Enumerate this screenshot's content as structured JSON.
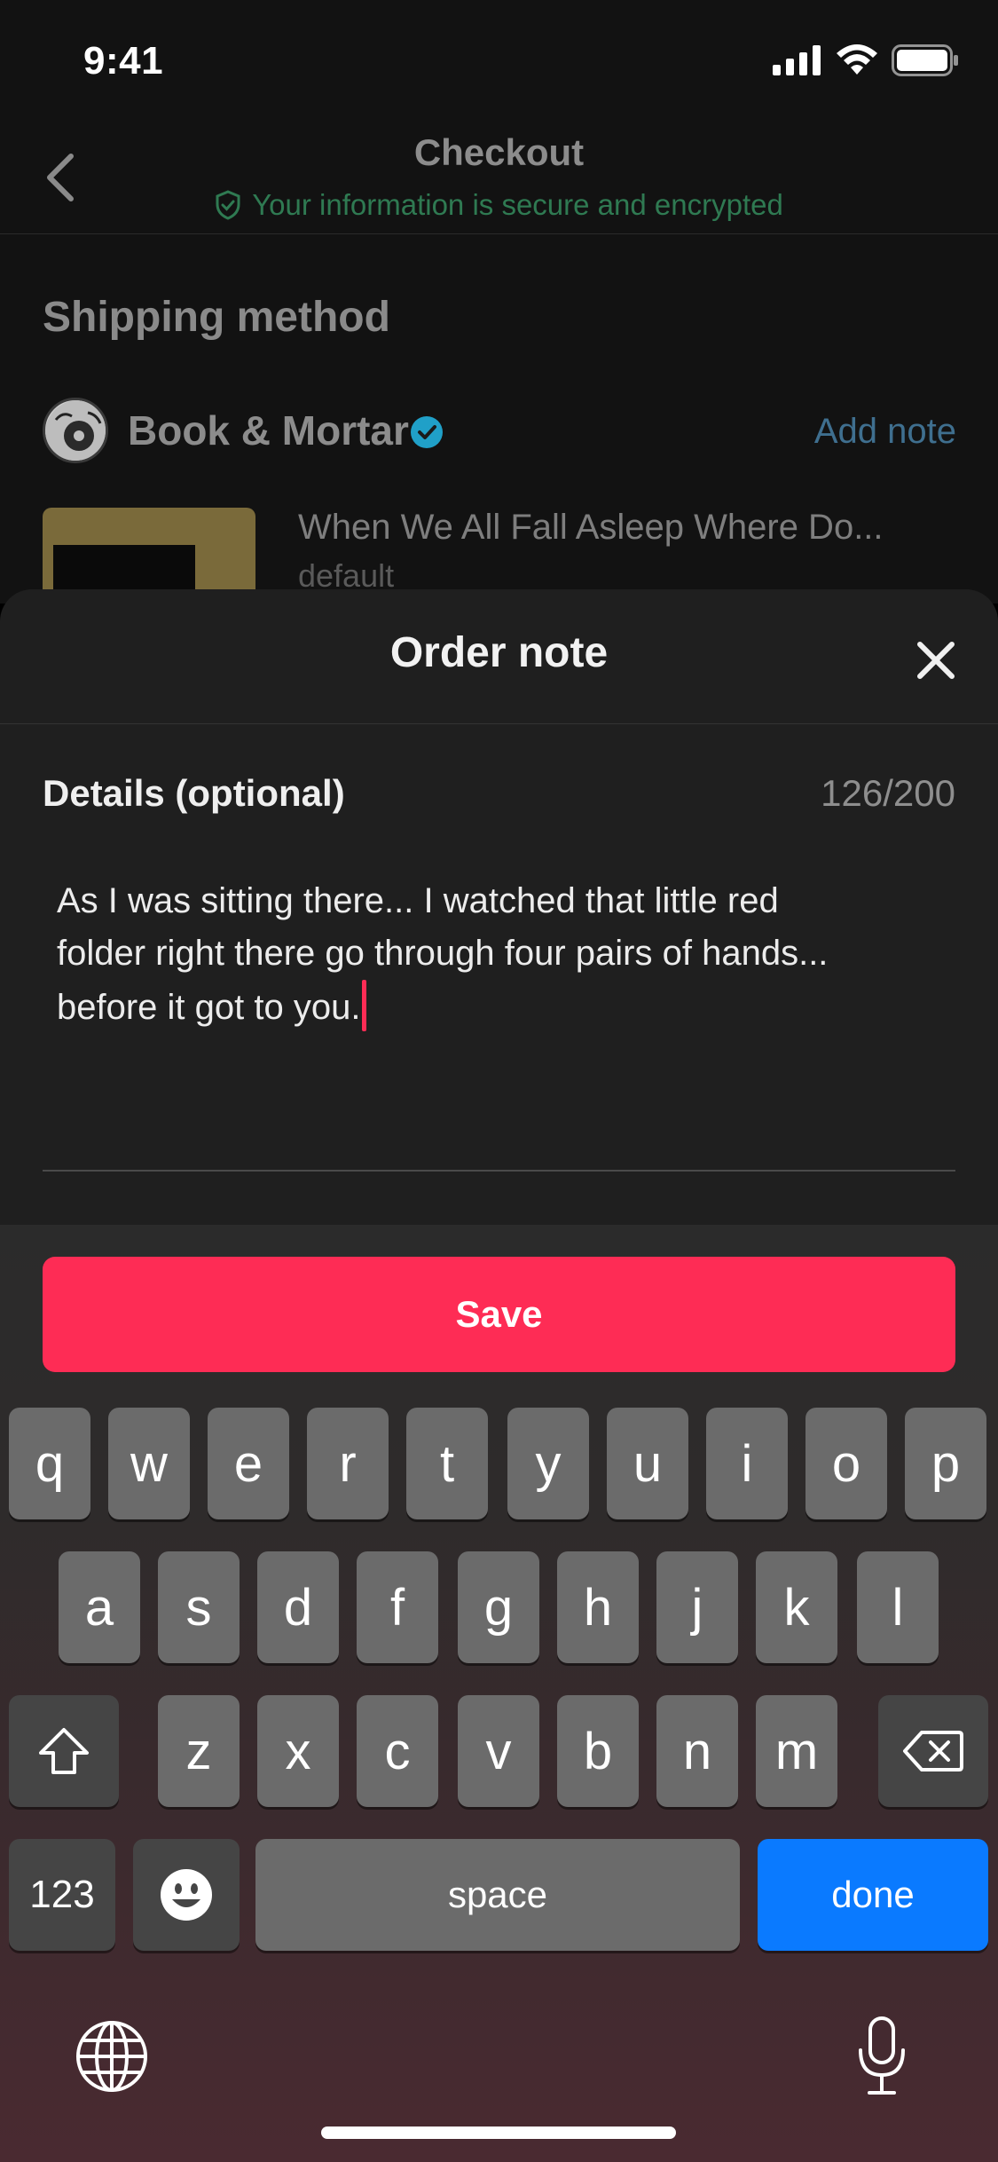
{
  "status_bar": {
    "time": "9:41"
  },
  "nav": {
    "title": "Checkout",
    "subtitle": "Your information is secure and encrypted"
  },
  "shipping": {
    "heading": "Shipping method",
    "shop_name": "Book & Mortar",
    "add_note": "Add note",
    "product_title": "When We All Fall Asleep Where Do...",
    "product_variant": "default"
  },
  "sheet": {
    "title": "Order note",
    "details_label": "Details (optional)",
    "counter": "126/200",
    "note_line1": "As I was sitting there... I watched that little red",
    "note_line2": "folder right there go through four pairs of hands...",
    "note_line3": "before it got to you."
  },
  "save_label": "Save",
  "keyboard": {
    "row1": [
      "q",
      "w",
      "e",
      "r",
      "t",
      "y",
      "u",
      "i",
      "o",
      "p"
    ],
    "row2": [
      "a",
      "s",
      "d",
      "f",
      "g",
      "h",
      "j",
      "k",
      "l"
    ],
    "row3": [
      "z",
      "x",
      "c",
      "v",
      "b",
      "n",
      "m"
    ],
    "numbers_key": "123",
    "space_key": "space",
    "done_key": "done"
  },
  "colors": {
    "accent": "#fe2c55",
    "done_key": "#0a7aff",
    "secure_text": "#2f7a52",
    "verified_badge": "#20a0c8"
  },
  "icons": [
    "back-icon",
    "shield-icon",
    "verified-badge-icon",
    "close-icon",
    "shift-icon",
    "backspace-icon",
    "emoji-icon",
    "globe-icon",
    "microphone-icon",
    "signal-icon",
    "wifi-icon",
    "battery-icon"
  ]
}
